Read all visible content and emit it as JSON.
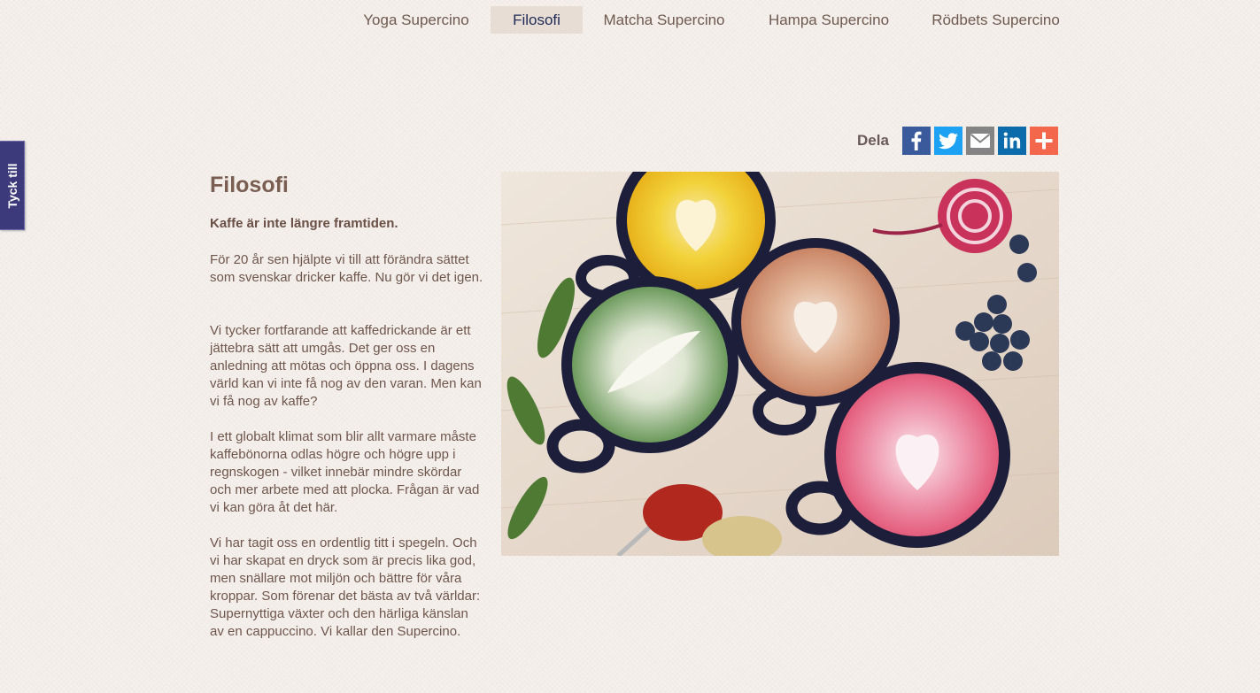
{
  "nav": {
    "items": [
      {
        "label": "Yoga Supercino"
      },
      {
        "label": "Filosofi",
        "active": true
      },
      {
        "label": "Matcha Supercino"
      },
      {
        "label": "Hampa Supercino"
      },
      {
        "label": "Rödbets Supercino"
      }
    ]
  },
  "feedback": {
    "label": "Tyck till"
  },
  "share": {
    "label": "Dela",
    "buttons": [
      {
        "icon": "facebook-icon",
        "color": "#3b5a9b"
      },
      {
        "icon": "twitter-icon",
        "color": "#1da1f2"
      },
      {
        "icon": "email-icon",
        "color": "#848484"
      },
      {
        "icon": "linkedin-icon",
        "color": "#0c6cab"
      },
      {
        "icon": "plus-icon",
        "color": "#f3674c"
      }
    ]
  },
  "article": {
    "title": "Filosofi",
    "lead": "Kaffe är inte längre framtiden.",
    "paragraphs": [
      "För 20 år sen hjälpte vi till att förändra sättet som svenskar dricker kaffe. Nu gör vi det igen.",
      "Vi tycker fortfarande att kaffedrickande är ett jättebra sätt att umgås. Det ger oss en anledning att mötas och öppna oss. I dagens värld kan vi inte få nog av den varan. Men kan vi få nog av kaffe?",
      "I ett globalt klimat som blir allt varmare måste kaffebönorna odlas högre och högre upp i regnskogen - vilket innebär mindre skördar och mer arbete med att plocka. Frågan är vad vi kan göra åt det här.",
      "Vi har tagit oss en ordentlig titt i spegeln. Och vi har skapat en dryck som är precis lika god, men snällare mot miljön och bättre för våra kroppar. Som förenar det bästa av två världar: Supernyttiga växter och den härliga känslan av en cappuccino. Vi kallar den Supercino."
    ]
  },
  "colors": {
    "background": "#f5f0ec",
    "active_nav_bg": "#e7ddd5",
    "text": "#7a5e52",
    "feedback_tab": "#3c3a7a"
  }
}
